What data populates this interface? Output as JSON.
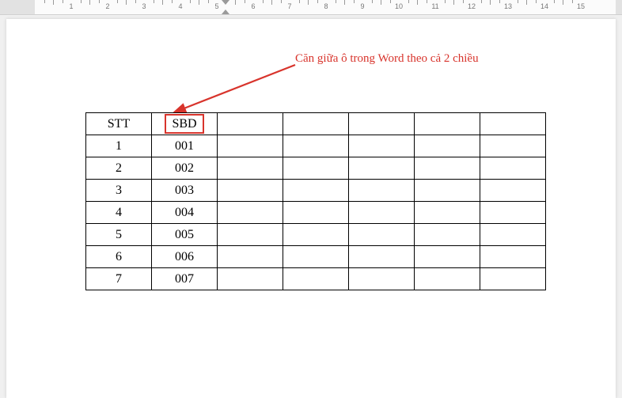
{
  "ruler": {
    "marks": [
      "1",
      "2",
      "3",
      "4",
      "5",
      "6",
      "7",
      "8",
      "9",
      "10",
      "11",
      "12",
      "13",
      "14",
      "15"
    ]
  },
  "annotation": {
    "text": "Căn giữa ô trong Word theo cả 2 chiều"
  },
  "table": {
    "header": [
      "STT",
      "SBD",
      "",
      "",
      "",
      "",
      ""
    ],
    "rows": [
      [
        "1",
        "001",
        "",
        "",
        "",
        "",
        ""
      ],
      [
        "2",
        "002",
        "",
        "",
        "",
        "",
        ""
      ],
      [
        "3",
        "003",
        "",
        "",
        "",
        "",
        ""
      ],
      [
        "4",
        "004",
        "",
        "",
        "",
        "",
        ""
      ],
      [
        "5",
        "005",
        "",
        "",
        "",
        "",
        ""
      ],
      [
        "6",
        "006",
        "",
        "",
        "",
        "",
        ""
      ],
      [
        "7",
        "007",
        "",
        "",
        "",
        "",
        ""
      ]
    ],
    "highlight": {
      "row": 0,
      "col": 1
    }
  }
}
